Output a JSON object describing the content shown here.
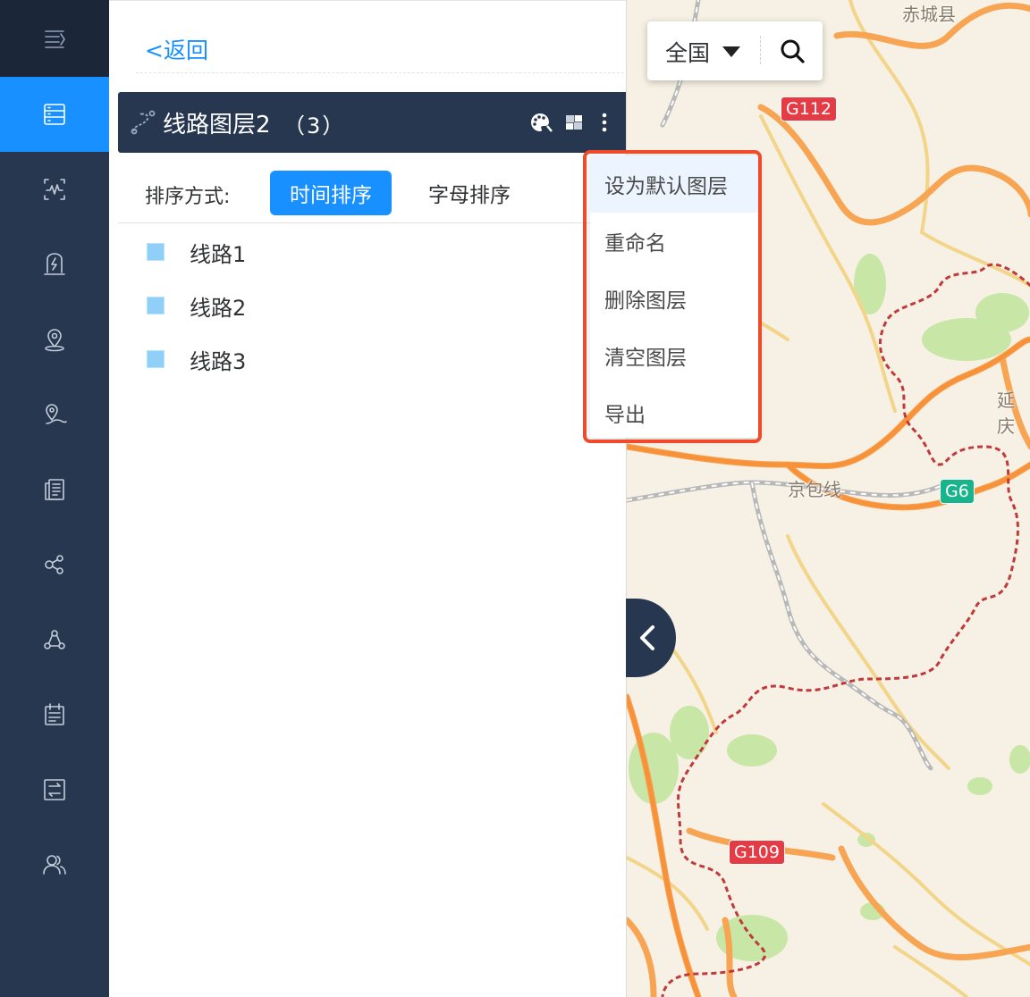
{
  "nav": {
    "items": [
      {
        "icon": "layers-list-icon",
        "active": true
      },
      {
        "icon": "track-analysis-icon"
      },
      {
        "icon": "power-device-icon"
      },
      {
        "icon": "location-pin-icon"
      },
      {
        "icon": "route-pin-icon"
      },
      {
        "icon": "document-list-icon"
      },
      {
        "icon": "share-nodes-icon"
      },
      {
        "icon": "cluster-icon"
      },
      {
        "icon": "calendar-icon"
      },
      {
        "icon": "transfer-icon"
      },
      {
        "icon": "users-icon"
      }
    ]
  },
  "panel": {
    "back_label": "<返回",
    "layer": {
      "title": "线路图层2",
      "count": "（3）"
    },
    "sort": {
      "label": "排序方式:",
      "time_label": "时间排序",
      "alpha_label": "字母排序",
      "active": "time"
    },
    "routes": [
      {
        "name": "线路1",
        "color": "#90d0f8"
      },
      {
        "name": "线路2",
        "color": "#90d0f8"
      },
      {
        "name": "线路3",
        "color": "#90d0f8"
      }
    ]
  },
  "context_menu": {
    "items": [
      {
        "label": "设为默认图层",
        "highlighted": true
      },
      {
        "label": "重命名"
      },
      {
        "label": "删除图层"
      },
      {
        "label": "清空图层"
      },
      {
        "label": "导出"
      }
    ],
    "outline_color": "#f04a2c"
  },
  "map": {
    "region_label": "全国",
    "labels": {
      "top_town": "赤城县",
      "right_town": "延庆",
      "railway": "京包线"
    },
    "road_shields": {
      "g112": "G112",
      "g6": "G6",
      "g109": "G109"
    }
  },
  "colors": {
    "nav_bg": "#283750",
    "accent": "#1890ff",
    "highway": "#f7913a",
    "border_line": "#c0393b"
  }
}
